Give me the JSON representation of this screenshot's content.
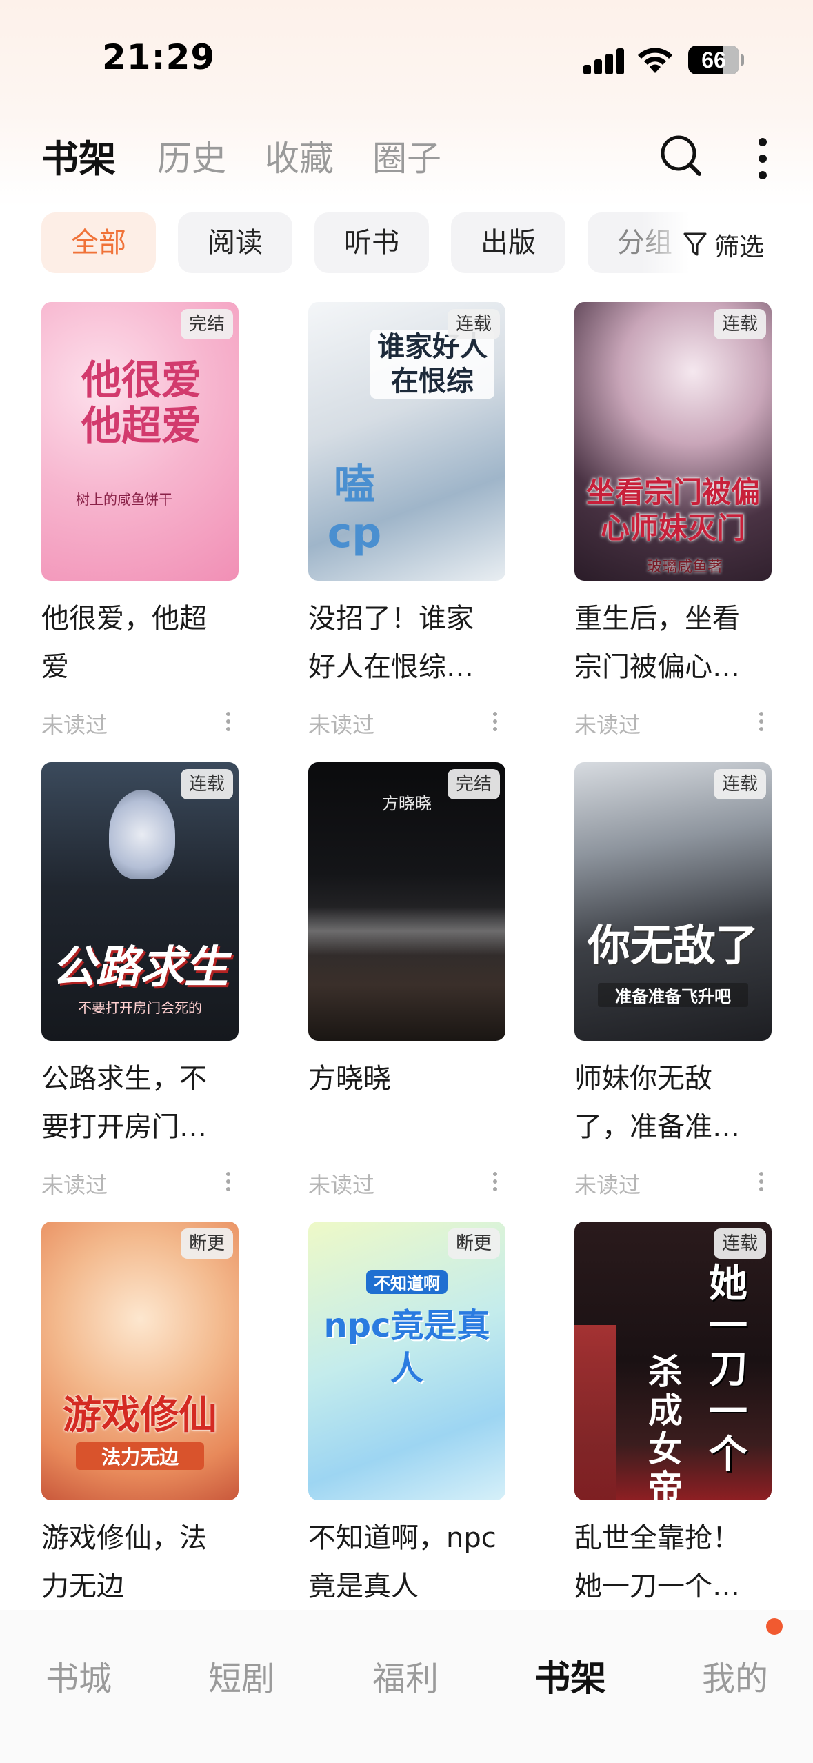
{
  "status_bar": {
    "time": "21:29",
    "battery": "66"
  },
  "top_nav": {
    "tabs": [
      {
        "label": "书架",
        "active": true
      },
      {
        "label": "历史",
        "active": false
      },
      {
        "label": "收藏",
        "active": false
      },
      {
        "label": "圈子",
        "active": false
      }
    ],
    "icons": [
      "search-icon",
      "more-vertical-icon"
    ]
  },
  "filters": {
    "chips": [
      {
        "label": "全部",
        "active": true
      },
      {
        "label": "阅读",
        "active": false
      },
      {
        "label": "听书",
        "active": false
      },
      {
        "label": "出版",
        "active": false
      },
      {
        "label": "分组",
        "active": false
      }
    ],
    "filter_label": "筛选"
  },
  "books": [
    {
      "title": "他很爱，他超爱",
      "display_title": "他很爱，他超\n爱",
      "badge": "完结",
      "status": "未读过",
      "cover_text": "他很爱他超爱",
      "cover_sub": "树上的咸鱼饼干"
    },
    {
      "title": "没招了！谁家好人在恨综…",
      "display_title": "没招了！谁家\n好人在恨综…",
      "badge": "连载",
      "status": "未读过",
      "cover_text": "谁家好人在恨综",
      "cover_sub": "嗑cp"
    },
    {
      "title": "重生后，坐看宗门被偏心…",
      "display_title": "重生后，坐看\n宗门被偏心…",
      "badge": "连载",
      "status": "未读过",
      "cover_text": "坐看宗门被偏心师妹灭门",
      "cover_sub": "玻璃咸鱼著"
    },
    {
      "title": "公路求生，不要打开房门…",
      "display_title": "公路求生，不\n要打开房门…",
      "badge": "连载",
      "status": "未读过",
      "cover_text": "公路求生",
      "cover_sub": "不要打开房门会死的"
    },
    {
      "title": "方晓晓",
      "display_title": "方晓晓",
      "badge": "完结",
      "status": "未读过",
      "cover_text": "方晓晓",
      "cover_sub": ""
    },
    {
      "title": "师妹你无敌了，准备准…",
      "display_title": "师妹你无敌\n了，准备准…",
      "badge": "连载",
      "status": "未读过",
      "cover_text": "你无敌了",
      "cover_sub": "准备准备飞升吧"
    },
    {
      "title": "游戏修仙，法力无边",
      "display_title": "游戏修仙，法\n力无边",
      "badge": "断更",
      "status": "",
      "cover_text": "游戏修仙",
      "cover_sub": "法力无边"
    },
    {
      "title": "不知道啊，npc竟是真人",
      "display_title": "不知道啊，npc\n竟是真人",
      "badge": "断更",
      "status": "",
      "cover_text": "npc竟是真人",
      "cover_sub": "不知道啊"
    },
    {
      "title": "乱世全靠抢！她一刀一个…",
      "display_title": "乱世全靠抢！\n她一刀一个…",
      "badge": "连载",
      "status": "",
      "cover_text": "她一刀一个",
      "cover_sub": "杀成女帝"
    }
  ],
  "tabbar": {
    "items": [
      {
        "label": "书城",
        "active": false
      },
      {
        "label": "短剧",
        "active": false
      },
      {
        "label": "福利",
        "active": false
      },
      {
        "label": "书架",
        "active": true
      },
      {
        "label": "我的",
        "active": false
      }
    ]
  },
  "colors": {
    "accent": "#f07238",
    "chip_active_bg": "#fdeee6",
    "chip_bg": "#f3f3f5",
    "muted_text": "#b5b5b5",
    "badge_dot": "#f15a30"
  }
}
